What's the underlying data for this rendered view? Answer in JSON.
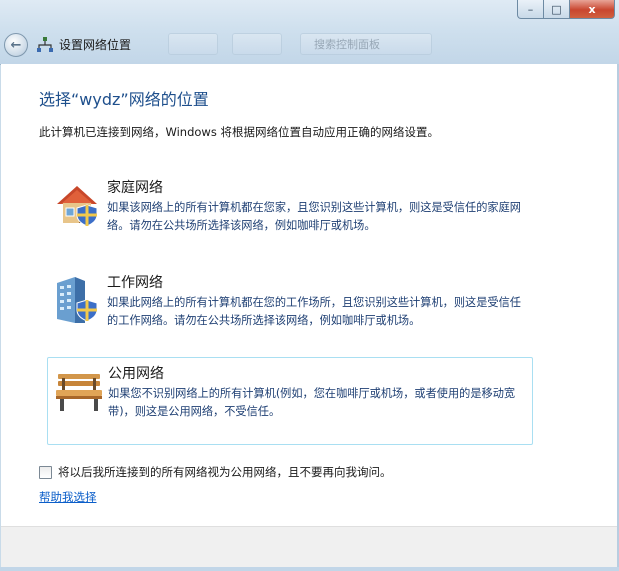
{
  "window": {
    "title": "设置网络位置",
    "ghost_address": "搜索控制面板",
    "caption_minimize": "–",
    "caption_maximize": "□",
    "caption_close": "x",
    "back_glyph": "←"
  },
  "page": {
    "heading": "选择“wydz”网络的位置",
    "intro": "此计算机已连接到网络，Windows 将根据网络位置自动应用正确的网络设置。"
  },
  "options": [
    {
      "title": "家庭网络",
      "description": "如果该网络上的所有计算机都在您家，且您识别这些计算机，则这是受信任的家庭网络。请勿在公共场所选择该网络，例如咖啡厅或机场。",
      "icon": "home-network-icon"
    },
    {
      "title": "工作网络",
      "description": "如果此网络上的所有计算机都在您的工作场所，且您识别这些计算机，则这是受信任的工作网络。请勿在公共场所选择该网络，例如咖啡厅或机场。",
      "icon": "work-network-icon"
    },
    {
      "title": "公用网络",
      "description": "如果您不识别网络上的所有计算机(例如，您在咖啡厅或机场，或者使用的是移动宽带)，则这是公用网络，不受信任。",
      "icon": "public-network-icon"
    }
  ],
  "checkbox": {
    "label": "将以后我所连接到的所有网络视为公用网络，且不要再向我询问。",
    "checked": false
  },
  "help_link": "帮助我选择",
  "colors": {
    "heading": "#1e4f8c",
    "description": "#1e3f73",
    "link": "#0b5ec9",
    "selection_border": "#a9dff2"
  }
}
